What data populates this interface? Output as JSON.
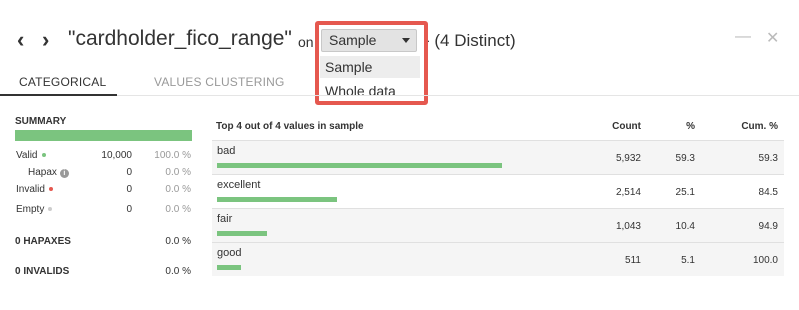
{
  "header": {
    "prev_icon": "chevron-left-icon",
    "next_icon": "chevron-right-icon",
    "title": "\"cardholder_fico_range\"",
    "on_word": "on",
    "distinct": "- (4 Distinct)",
    "minimize_icon": "minus-icon",
    "close_icon": "close-icon"
  },
  "sample_dropdown": {
    "selected": "Sample",
    "options": [
      "Sample",
      "Whole data"
    ],
    "highlight_color": "#e5584f"
  },
  "tabs": [
    {
      "label": "CATEGORICAL",
      "active": true
    },
    {
      "label": "VALUES CLUSTERING",
      "active": false
    }
  ],
  "summary": {
    "title": "SUMMARY",
    "rows": [
      {
        "label": "Valid",
        "count": "10,000",
        "pct": "100.0 %",
        "dot_color": "#7bc47f"
      },
      {
        "label": "Hapax",
        "count": "0",
        "pct": "0.0 %"
      },
      {
        "label": "Invalid",
        "count": "0",
        "pct": "0.0 %",
        "dot_color": "#e5584f"
      },
      {
        "label": "Empty",
        "count": "0",
        "pct": "0.0 %",
        "dot_color": "#cccccc"
      }
    ],
    "hapaxes_label": "0 HAPAXES",
    "hapaxes_pct": "0.0 %",
    "invalids_label": "0 INVALIDS",
    "invalids_pct": "0.0 %"
  },
  "table": {
    "title": "Top 4 out of 4 values in sample",
    "col_count": "Count",
    "col_pct": "%",
    "col_cum": "Cum. %",
    "bar_color": "#7bc47f",
    "rows": [
      {
        "value": "bad",
        "count": "5,932",
        "pct": "59.3",
        "cum": "59.3",
        "share": 0.593
      },
      {
        "value": "excellent",
        "count": "2,514",
        "pct": "25.1",
        "cum": "84.5",
        "share": 0.251
      },
      {
        "value": "fair",
        "count": "1,043",
        "pct": "10.4",
        "cum": "94.9",
        "share": 0.104
      },
      {
        "value": "good",
        "count": "511",
        "pct": "5.1",
        "cum": "100.0",
        "share": 0.051
      }
    ]
  }
}
